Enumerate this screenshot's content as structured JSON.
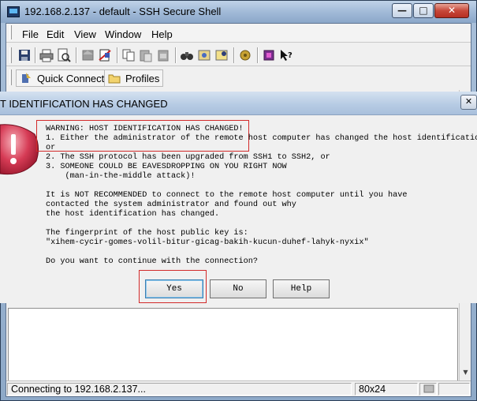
{
  "window": {
    "title": "192.168.2.137 - default - SSH Secure Shell",
    "minimize": "—",
    "maximize": "□",
    "close": "✕"
  },
  "menu": [
    "File",
    "Edit",
    "View",
    "Window",
    "Help"
  ],
  "toolbar": {
    "quick_connect": "Quick Connect",
    "profiles": "Profiles"
  },
  "dialog": {
    "title": "T IDENTIFICATION HAS CHANGED",
    "close": "✕",
    "lines": [
      "WARNING: HOST IDENTIFICATION HAS CHANGED!",
      "1. Either the administrator of the remote host computer has changed the host identification",
      "or",
      "2. The SSH protocol has been upgraded from SSH1 to SSH2, or",
      "3. SOMEONE COULD BE EAVESDROPPING ON YOU RIGHT NOW",
      "    (man-in-the-middle attack)!",
      "It is NOT RECOMMENDED to connect to the remote host computer until you have",
      "contacted the system administrator and found out why",
      "the host identification has changed.",
      "The fingerprint of the host public key is:",
      "\"xihem-cycir-gomes-volil-bitur-gicag-bakih-kucun-duhef-lahyk-nyxix\"",
      "Do you want to continue with the connection?"
    ],
    "buttons": {
      "yes": "Yes",
      "no": "No",
      "help": "Help"
    }
  },
  "status": {
    "message": "Connecting to 192.168.2.137...",
    "size": "80x24"
  },
  "colors": {
    "highlight": "#d22a2a",
    "titlebar": "#a9c0dc"
  }
}
